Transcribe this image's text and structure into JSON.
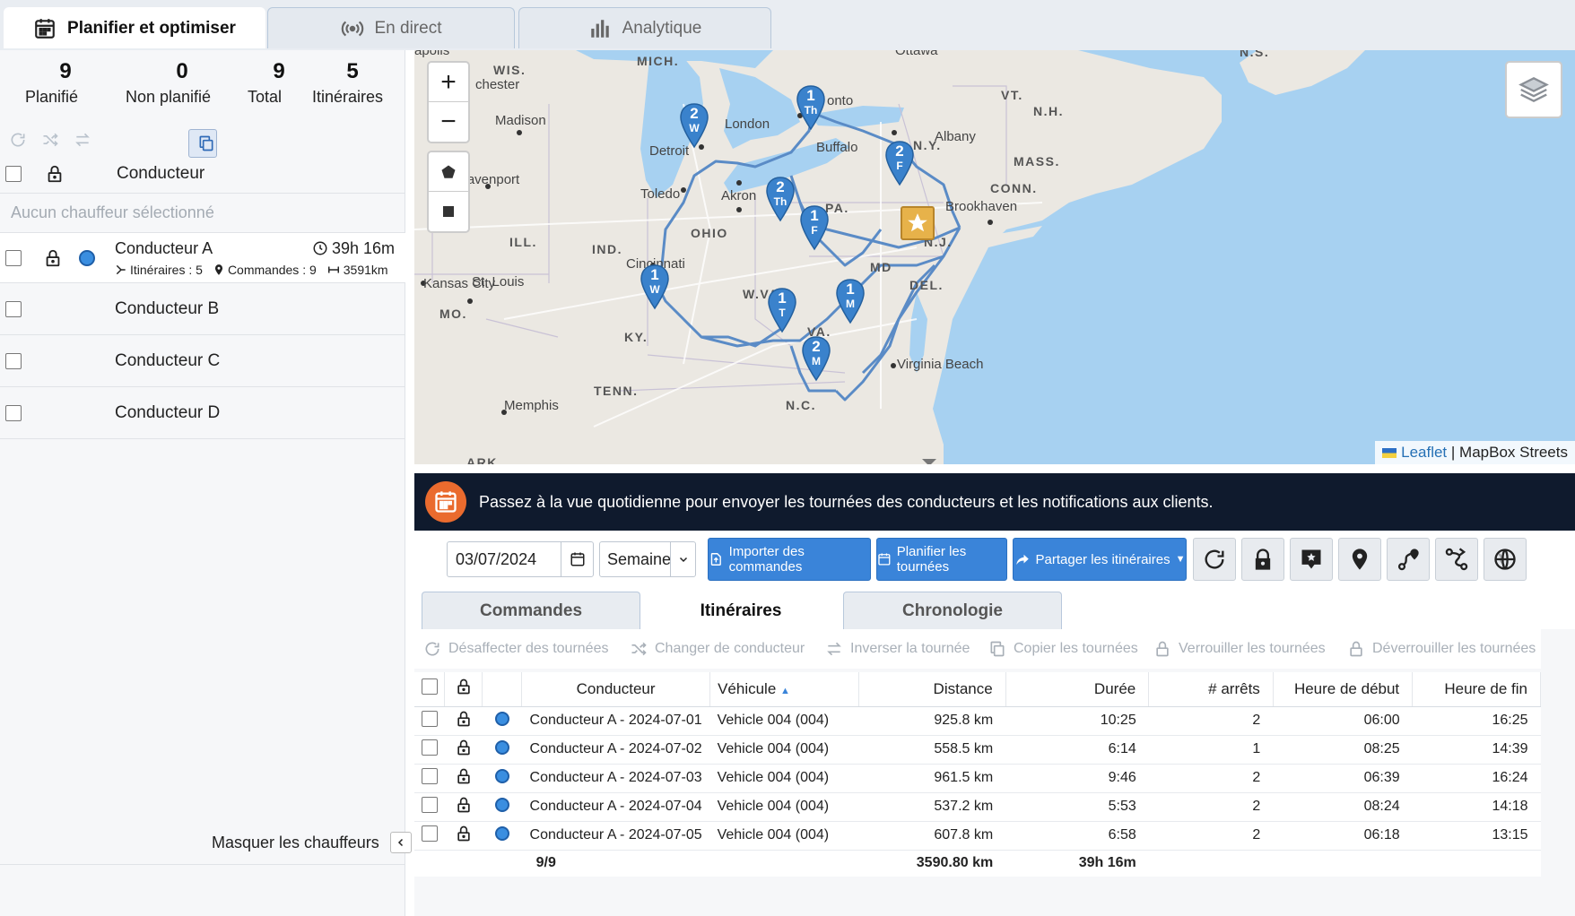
{
  "tabs": [
    {
      "label": "Planifier et optimiser",
      "icon": "calendar-icon"
    },
    {
      "label": "En direct",
      "icon": "broadcast-icon"
    },
    {
      "label": "Analytique",
      "icon": "bar-chart-icon"
    }
  ],
  "left": {
    "stats": [
      {
        "value": "9",
        "label": "Planifié"
      },
      {
        "value": "0",
        "label": "Non planifié"
      },
      {
        "value": "9",
        "label": "Total"
      },
      {
        "value": "5",
        "label": "Itinéraires"
      }
    ],
    "header_label": "Conducteur",
    "no_driver": "Aucun chauffeur sélectionné",
    "driver_a": {
      "name": "Conducteur A",
      "duration": "39h 16m",
      "routes": "Itinéraires : 5",
      "orders": "Commandes : 9",
      "distance": "3591km",
      "color": "#3a8ee0"
    },
    "drivers": [
      "Conducteur B",
      "Conducteur C",
      "Conducteur D"
    ],
    "hide_label": "Masquer les chauffeurs"
  },
  "map": {
    "labels": {
      "mich": "MICH.",
      "wis": "WIS.",
      "ill": "ILL.",
      "ind": "IND.",
      "ohio": "OHIO",
      "ky": "KY.",
      "tenn": "TENN.",
      "mo": "MO.",
      "wva": "W.VA.",
      "va": "VA.",
      "pa": "PA.",
      "md": "MD",
      "del": "DEL.",
      "nj": "N.J.",
      "ny": "N.Y.",
      "vt": "VT.",
      "nh": "N.H.",
      "mass": "MASS.",
      "conn": "CONN.",
      "ns": "N.S.",
      "nc": "N.C.",
      "ark": "ARK",
      "madison": "Madison",
      "chester": "chester",
      "apolis": "apolis",
      "detroit": "Detroit",
      "london": "London",
      "ontario": "onto",
      "buffalo": "Buffalo",
      "albany": "Albany",
      "davenport": "Davenport",
      "toledo": "Toledo",
      "akron": "Akron",
      "brookhaven": "Brookhaven",
      "cincinnati": "Cincinnati",
      "kansas": "Kansas City",
      "stlouis": "St. Louis",
      "memphis": "Memphis",
      "virginia": "Virginia Beach",
      "ottawa": "Ottawa"
    },
    "markers": [
      {
        "n": "2",
        "d": "W"
      },
      {
        "n": "1",
        "d": "Th"
      },
      {
        "n": "2",
        "d": "F"
      },
      {
        "n": "2",
        "d": "Th"
      },
      {
        "n": "1",
        "d": "F"
      },
      {
        "n": "1",
        "d": "W"
      },
      {
        "n": "1",
        "d": "T"
      },
      {
        "n": "1",
        "d": "M"
      },
      {
        "n": "2",
        "d": "M"
      }
    ],
    "attribution_leaflet": "Leaflet",
    "attribution_sep": "|",
    "attribution_tiles": "MapBox Streets",
    "colors": {
      "water": "#a7d1f1",
      "land": "#ebe8e2",
      "route": "#5a8bc6",
      "marker": "#3a82cc"
    }
  },
  "banner": "Passez à la vue quotidienne pour envoyer les tournées des conducteurs et les notifications aux clients.",
  "toolbar": {
    "date": "03/07/2024",
    "period": "Semaine",
    "import": "Importer des commandes",
    "plan": "Planifier les tournées",
    "share": "Partager les itinéraires"
  },
  "subtabs": [
    "Commandes",
    "Itinéraires",
    "Chronologie"
  ],
  "actions": [
    "Désaffecter des tournées",
    "Changer de conducteur",
    "Inverser la tournée",
    "Copier les tournées",
    "Verrouiller les tournées",
    "Déverrouiller les tournées"
  ],
  "table": {
    "headers": {
      "driver": "Conducteur",
      "vehicle": "Véhicule",
      "distance": "Distance",
      "duration": "Durée",
      "stops": "# arrêts",
      "start": "Heure de début",
      "end": "Heure de fin"
    },
    "rows": [
      {
        "driver": "Conducteur A - 2024-07-01",
        "vehicle": "Vehicle 004 (004)",
        "distance": "925.8 km",
        "duration": "10:25",
        "stops": "2",
        "start": "06:00",
        "end": "16:25"
      },
      {
        "driver": "Conducteur A - 2024-07-02",
        "vehicle": "Vehicle 004 (004)",
        "distance": "558.5 km",
        "duration": "6:14",
        "stops": "1",
        "start": "08:25",
        "end": "14:39"
      },
      {
        "driver": "Conducteur A - 2024-07-03",
        "vehicle": "Vehicle 004 (004)",
        "distance": "961.5 km",
        "duration": "9:46",
        "stops": "2",
        "start": "06:39",
        "end": "16:24"
      },
      {
        "driver": "Conducteur A - 2024-07-04",
        "vehicle": "Vehicle 004 (004)",
        "distance": "537.2 km",
        "duration": "5:53",
        "stops": "2",
        "start": "08:24",
        "end": "14:18"
      },
      {
        "driver": "Conducteur A - 2024-07-05",
        "vehicle": "Vehicle 004 (004)",
        "distance": "607.8 km",
        "duration": "6:58",
        "stops": "2",
        "start": "06:18",
        "end": "13:15"
      }
    ],
    "footer": {
      "count": "9/9",
      "distance": "3590.80 km",
      "duration": "39h 16m"
    }
  }
}
